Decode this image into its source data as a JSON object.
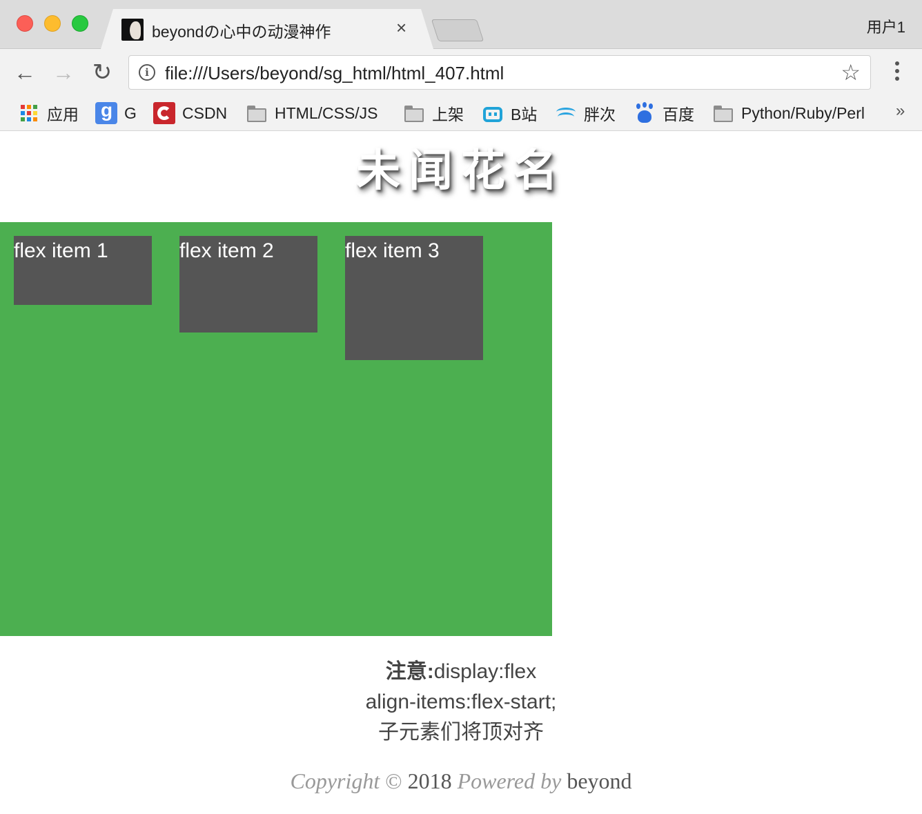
{
  "browser": {
    "tab_title": "beyondの心中の动漫神作",
    "tab_close": "×",
    "profile_name": "用户1",
    "url": "file:///Users/beyond/sg_html/html_407.html",
    "back_glyph": "←",
    "forward_glyph": "→",
    "reload_glyph": "↻",
    "info_glyph": "i",
    "star_glyph": "☆",
    "more_bookmarks_glyph": "»",
    "bookmarks": [
      {
        "label": "应用",
        "icon": "apps-grid-icon"
      },
      {
        "label": "G",
        "icon": "google-maps-icon"
      },
      {
        "label": "CSDN",
        "icon": "csdn-icon"
      },
      {
        "label": "HTML/CSS/JS",
        "icon": "folder-icon"
      },
      {
        "label": "上架",
        "icon": "folder-icon"
      },
      {
        "label": "B站",
        "icon": "bilibili-icon"
      },
      {
        "label": "胖次",
        "icon": "pangci-icon"
      },
      {
        "label": "百度",
        "icon": "baidu-icon"
      },
      {
        "label": "Python/Ruby/Perl",
        "icon": "folder-icon"
      }
    ]
  },
  "page": {
    "title": "未闻花名",
    "flex_items": [
      "flex item 1",
      "flex item 2",
      "flex item 3"
    ],
    "note": {
      "label": "注意:",
      "line1": "display:flex",
      "line2": "align-items:flex-start;",
      "line3": "子元素们将顶对齐"
    },
    "footer": {
      "copyright": "Copyright",
      "symbol": "©",
      "year": "2018",
      "powered_by": "Powered by",
      "author": "beyond"
    }
  },
  "colors": {
    "container": "#4caf50",
    "item": "#555555",
    "titlebar": "#dcdcdc",
    "toolbar": "#f2f2f2"
  }
}
